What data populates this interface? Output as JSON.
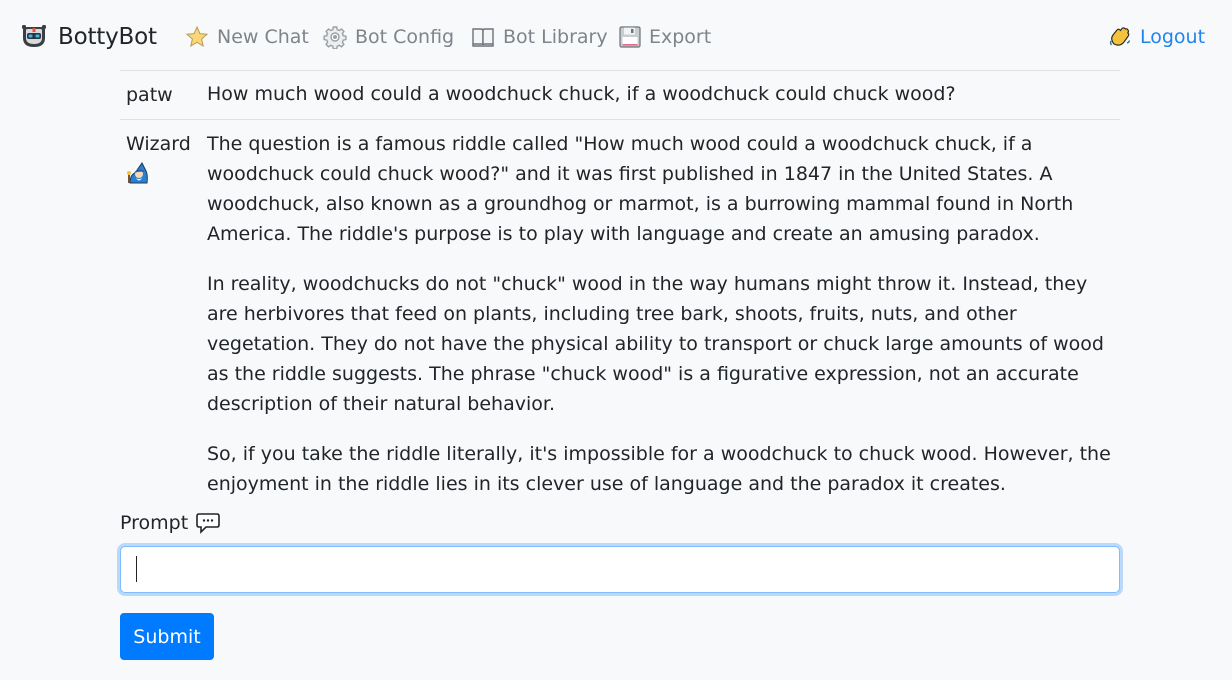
{
  "navbar": {
    "brand": "BottyBot",
    "links": {
      "new_chat": "New Chat",
      "bot_config": "Bot Config",
      "bot_library": "Bot Library",
      "export": "Export",
      "logout": "Logout"
    }
  },
  "chat": {
    "messages": [
      {
        "author": "patw",
        "text": "How much wood could a woodchuck chuck, if a woodchuck could chuck wood?"
      },
      {
        "author": "Wizard",
        "paragraphs": [
          "The question is a famous riddle called \"How much wood could a woodchuck chuck, if a woodchuck could chuck wood?\" and it was first published in 1847 in the United States. A woodchuck, also known as a groundhog or marmot, is a burrowing mammal found in North America. The riddle's purpose is to play with language and create an amusing paradox.",
          "In reality, woodchucks do not \"chuck\" wood in the way humans might throw it. Instead, they are herbivores that feed on plants, including tree bark, shoots, fruits, nuts, and other vegetation. They do not have the physical ability to transport or chuck large amounts of wood as the riddle suggests. The phrase \"chuck wood\" is a figurative expression, not an accurate description of their natural behavior.",
          "So, if you take the riddle literally, it's impossible for a woodchuck to chuck wood. However, the enjoyment in the riddle lies in its clever use of language and the paradox it creates."
        ]
      }
    ]
  },
  "prompt": {
    "label": "Prompt",
    "value": "",
    "submit_label": "Submit"
  },
  "colors": {
    "accent": "#007bff",
    "link": "#1f84ee",
    "muted_nav": "#7d848b",
    "background": "#f8f9fa"
  }
}
